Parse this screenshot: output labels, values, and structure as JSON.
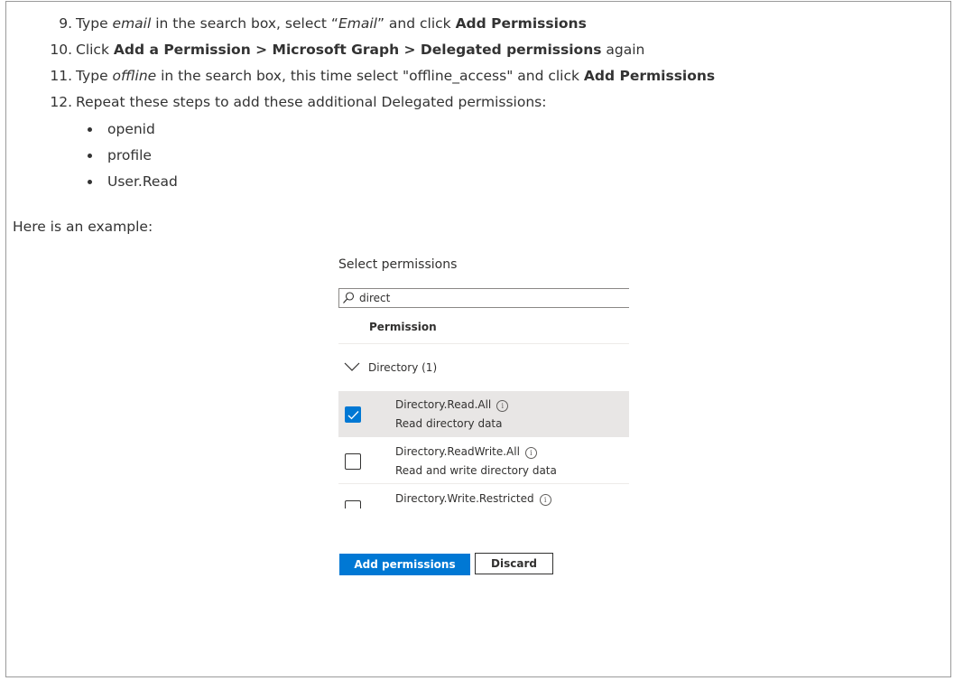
{
  "steps": [
    {
      "num": "9.",
      "parts": [
        {
          "t": "Type "
        },
        {
          "t": "email",
          "i": true
        },
        {
          "t": " in the search box, select “"
        },
        {
          "t": "Email",
          "i": true
        },
        {
          "t": "” and click "
        },
        {
          "t": "Add Permissions",
          "b": true
        }
      ]
    },
    {
      "num": "10.",
      "parts": [
        {
          "t": "Click "
        },
        {
          "t": "Add a Permission > Microsoft Graph > Delegated permissions",
          "b": true
        },
        {
          "t": " again"
        }
      ]
    },
    {
      "num": "11.",
      "parts": [
        {
          "t": "Type "
        },
        {
          "t": "offline",
          "i": true
        },
        {
          "t": " in the search box, this time select \"offline_access\" and click "
        },
        {
          "t": "Add Permissions",
          "b": true
        }
      ]
    },
    {
      "num": "12.",
      "parts": [
        {
          "t": "Repeat these steps to add these additional Delegated permissions:"
        }
      ]
    }
  ],
  "bullets": [
    "openid",
    "profile",
    "User.Read"
  ],
  "intro": "Here is an example:",
  "example": {
    "title": "Select permissions",
    "search_value": "direct",
    "column_header": "Permission",
    "group_label": "Directory (1)",
    "permissions": [
      {
        "name": "Directory.Read.All",
        "description": "Read directory data",
        "checked": true
      },
      {
        "name": "Directory.ReadWrite.All",
        "description": "Read and write directory data",
        "checked": false
      },
      {
        "name": "Directory.Write.Restricted",
        "description": "",
        "checked": false
      }
    ],
    "add_button": "Add permissions",
    "discard_button": "Discard"
  },
  "colors": {
    "accent": "#0078d4",
    "selected_row": "#e8e6e5",
    "text": "#333333"
  }
}
